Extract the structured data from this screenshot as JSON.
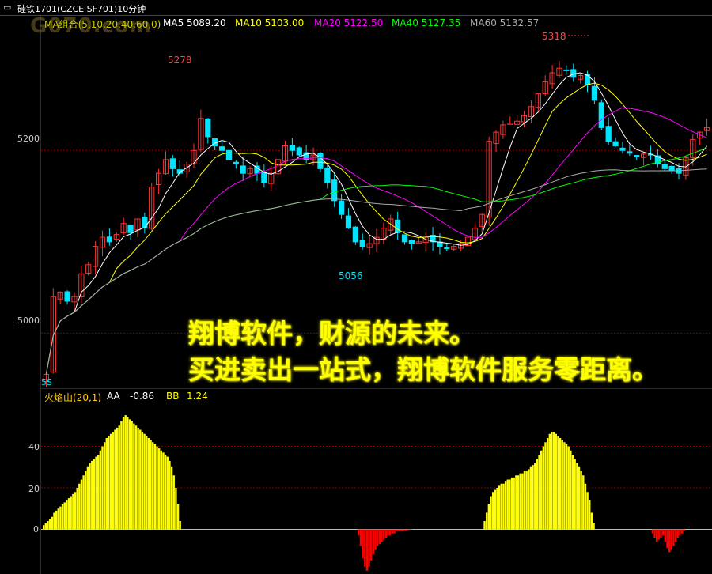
{
  "header": {
    "window_glyph": "▭",
    "title": "硅铁1701(CZCE SF701)10分钟"
  },
  "watermark": "G070.com",
  "main_indicator": {
    "group_label": "MA组合(5,10,20,40,60,0)",
    "items": [
      {
        "label": "MA5 5089.20",
        "color": "#ffffff"
      },
      {
        "label": "MA10 5103.00",
        "color": "#ffff00"
      },
      {
        "label": "MA20 5122.50",
        "color": "#ff00ff"
      },
      {
        "label": "MA40 5127.35",
        "color": "#00ff00"
      },
      {
        "label": "MA60 5132.57",
        "color": "#aaaaaa"
      }
    ]
  },
  "sub_indicator": {
    "name": "火焰山(20,1)",
    "aa_label": "AA",
    "aa_value": "-0.86",
    "bb_label": "BB",
    "bb_value": "1.24"
  },
  "promo": {
    "line1": "翔博软件，财源的未来。",
    "line2": "买进卖出一站式，翔博软件服务零距离。"
  },
  "annotations": {
    "high_left": "5278",
    "high_right": "5318",
    "low_mid": "5056",
    "bottom_tag": "5S"
  },
  "colors": {
    "up": "#ff3333",
    "down": "#00e5ff",
    "grid": "#8b0000",
    "flame_pos": "#ffff00",
    "flame_neg": "#ff0000"
  },
  "chart_data": [
    {
      "type": "candlestick",
      "title": "硅铁1701(CZCE SF701)10分钟",
      "yticks": [
        5000,
        5200
      ],
      "ylim": [
        4945,
        5330
      ],
      "marked_high": [
        5278,
        5318
      ],
      "marked_low": 5056,
      "close_path": [
        4955,
        5040,
        5045,
        5035,
        5040,
        5065,
        5075,
        5095,
        5105,
        5100,
        5108,
        5120,
        5110,
        5125,
        5115,
        5160,
        5175,
        5190,
        5180,
        5175,
        5185,
        5200,
        5235,
        5215,
        5205,
        5200,
        5190,
        5185,
        5175,
        5180,
        5175,
        5165,
        5175,
        5190,
        5205,
        5200,
        5195,
        5190,
        5195,
        5180,
        5165,
        5145,
        5130,
        5115,
        5100,
        5095,
        5098,
        5105,
        5115,
        5125,
        5110,
        5100,
        5098,
        5100,
        5105,
        5100,
        5095,
        5093,
        5095,
        5098,
        5105,
        5115,
        5130,
        5210,
        5220,
        5228,
        5230,
        5232,
        5238,
        5248,
        5262,
        5275,
        5285,
        5290,
        5288,
        5280,
        5282,
        5272,
        5255,
        5225,
        5210,
        5205,
        5200,
        5197,
        5193,
        5196,
        5195,
        5185,
        5180,
        5178,
        5175,
        5192,
        5212,
        5220,
        5225
      ],
      "series": [
        {
          "name": "MA5",
          "value": 5089.2
        },
        {
          "name": "MA10",
          "value": 5103.0
        },
        {
          "name": "MA20",
          "value": 5122.5
        },
        {
          "name": "MA40",
          "value": 5127.35
        },
        {
          "name": "MA60",
          "value": 5132.57
        }
      ]
    },
    {
      "type": "bar",
      "title": "火焰山(20,1)",
      "yticks": [
        0,
        20,
        40
      ],
      "ylim": [
        -20,
        60
      ],
      "segments": [
        {
          "start": 0,
          "end": 24,
          "values": [
            2,
            3,
            4,
            5,
            6,
            8,
            9,
            10,
            11,
            12,
            13,
            14,
            15,
            16,
            17,
            18,
            20,
            22,
            24,
            26,
            28,
            30,
            32,
            33,
            34
          ]
        },
        {
          "start": 25,
          "end": 48,
          "values": [
            35,
            36,
            38,
            40,
            42,
            44,
            45,
            46,
            47,
            48,
            49,
            50,
            52,
            54,
            55,
            54,
            53,
            52,
            51,
            50,
            49,
            48,
            47,
            46
          ]
        },
        {
          "start": 49,
          "end": 65,
          "values": [
            45,
            44,
            43,
            42,
            41,
            40,
            39,
            38,
            37,
            36,
            35,
            33,
            30,
            26,
            20,
            12,
            4
          ]
        },
        {
          "start": 150,
          "end": 175,
          "values": [
            -3,
            -8,
            -14,
            -18,
            -20,
            -18,
            -15,
            -12,
            -10,
            -8,
            -7,
            -6,
            -5,
            -4,
            -3,
            -3,
            -2,
            -2,
            -1,
            -1,
            -1,
            -1,
            -0.5,
            -0.5,
            -0.3,
            -0.2
          ]
        },
        {
          "start": 210,
          "end": 244,
          "values": [
            4,
            8,
            12,
            16,
            18,
            19,
            20,
            21,
            22,
            22,
            23,
            24,
            24,
            25,
            25,
            26,
            26,
            27,
            27,
            28,
            28,
            29,
            30,
            31,
            32,
            34,
            36,
            38,
            40,
            42,
            44,
            46,
            47,
            47,
            46
          ]
        },
        {
          "start": 245,
          "end": 262,
          "values": [
            45,
            44,
            43,
            42,
            41,
            40,
            38,
            36,
            34,
            32,
            30,
            28,
            26,
            22,
            18,
            14,
            8,
            3
          ]
        },
        {
          "start": 290,
          "end": 305,
          "values": [
            -2,
            -4,
            -6,
            -5,
            -4,
            -3,
            -6,
            -9,
            -11,
            -10,
            -8,
            -6,
            -4,
            -3,
            -2,
            -1
          ]
        }
      ],
      "aa": -0.86,
      "bb": 1.24
    }
  ]
}
